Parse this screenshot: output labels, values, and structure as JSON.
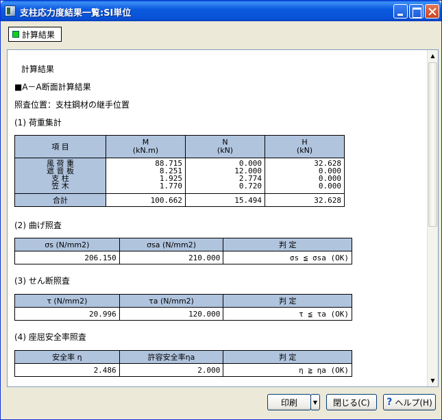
{
  "window": {
    "title": "支柱応力度結果一覧:SI単位"
  },
  "tab": {
    "label": "計算結果"
  },
  "content": {
    "heading": "計算結果",
    "section_ab": "■A－A断面計算結果",
    "check_position": "照査位置：支柱鋼材の継手位置",
    "load_title": "(1) 荷重集計",
    "load_table": {
      "col_item": "項 目",
      "col_m": "M",
      "col_m_unit": "(kN.m)",
      "col_n": "N",
      "col_n_unit": "(kN)",
      "col_h": "H",
      "col_h_unit": "(kN)",
      "rows": [
        {
          "label": "風 荷 重",
          "m": "88.715",
          "n": "0.000",
          "h": "32.628"
        },
        {
          "label": "遮 音 板",
          "m": "8.251",
          "n": "12.000",
          "h": "0.000"
        },
        {
          "label": "支 柱",
          "m": "1.925",
          "n": "2.774",
          "h": "0.000"
        },
        {
          "label": "笠 木",
          "m": "1.770",
          "n": "0.720",
          "h": "0.000"
        }
      ],
      "total_label": "合計",
      "total_m": "100.662",
      "total_n": "15.494",
      "total_h": "32.628"
    },
    "bend_title": "(2) 曲げ照査",
    "bend_table": {
      "col1": "σs (N/mm2)",
      "col2": "σsa (N/mm2)",
      "col3": "判 定",
      "v1": "206.150",
      "v2": "210.000",
      "v3": "σs ≦ σsa (OK)"
    },
    "shear_title": "(3) せん断照査",
    "shear_table": {
      "col1": "τ (N/mm2)",
      "col2": "τa (N/mm2)",
      "col3": "判 定",
      "v1": "20.996",
      "v2": "120.000",
      "v3": "τ ≦ τa (OK)"
    },
    "buckle_title": "(4) 座屈安全率照査",
    "buckle_table": {
      "col1": "安全率 η",
      "col2": "許容安全率ηa",
      "col3": "判 定",
      "v1": "2.486",
      "v2": "2.000",
      "v3": "η ≧ ηa (OK)"
    }
  },
  "buttons": {
    "print": "印刷",
    "close": "閉じる(C)",
    "help": "ヘルプ(H)"
  }
}
